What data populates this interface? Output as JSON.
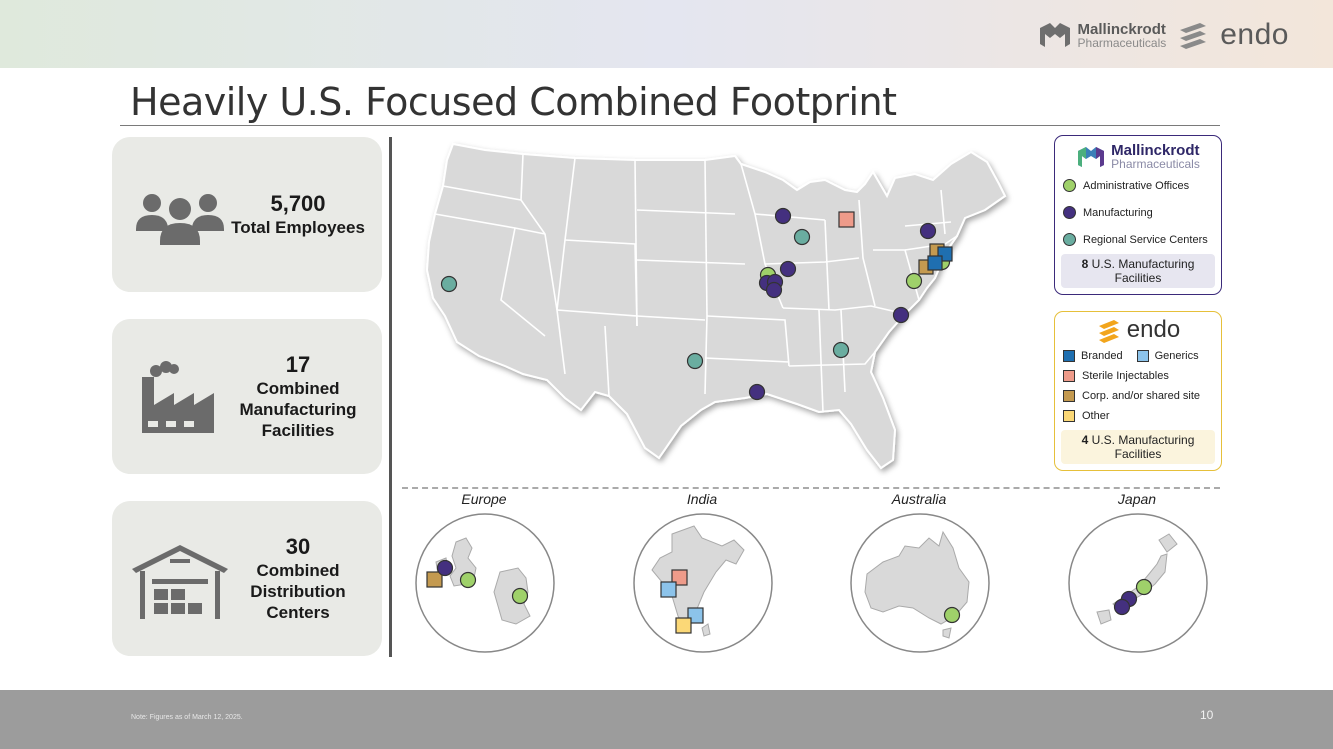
{
  "header": {
    "mallinckrodt_name": "Mallinckrodt",
    "mallinckrodt_sub": "Pharmaceuticals",
    "endo_name": "endo"
  },
  "title": "Heavily U.S. Focused Combined Footprint",
  "stats": [
    {
      "number": "5,700",
      "label_lines": [
        "Total Employees"
      ],
      "icon": "people-icon"
    },
    {
      "number": "17",
      "label_lines": [
        "Combined",
        "Manufacturing",
        "Facilities"
      ],
      "icon": "factory-icon"
    },
    {
      "number": "30",
      "label_lines": [
        "Combined",
        "Distribution",
        "Centers"
      ],
      "icon": "warehouse-icon"
    }
  ],
  "legend_mallinckrodt": {
    "name": "Mallinckrodt",
    "sub": "Pharmaceuticals",
    "items": [
      {
        "label": "Administrative Offices",
        "color": "#9fd16a"
      },
      {
        "label": "Manufacturing",
        "color": "#44307f"
      },
      {
        "label": "Regional Service Centers",
        "color": "#6aada0"
      }
    ],
    "footer_bold": "8",
    "footer_text": "U.S. Manufacturing Facilities"
  },
  "legend_endo": {
    "name": "endo",
    "items": [
      {
        "label": "Branded",
        "color": "#1f6fb0"
      },
      {
        "label": "Generics",
        "color": "#8cc3ea"
      },
      {
        "label": "Sterile Injectables",
        "color": "#ee9b8a"
      },
      {
        "label": "Corp. and/or shared site",
        "color": "#c49a50"
      },
      {
        "label": "Other",
        "color": "#fbd877"
      }
    ],
    "footer_bold": "4",
    "footer_text": "U.S. Manufacturing Facilities"
  },
  "regions": [
    "Europe",
    "India",
    "Australia",
    "Japan"
  ],
  "footer": {
    "note": "Note: Figures as of March 12, 2025.",
    "page": "10"
  }
}
